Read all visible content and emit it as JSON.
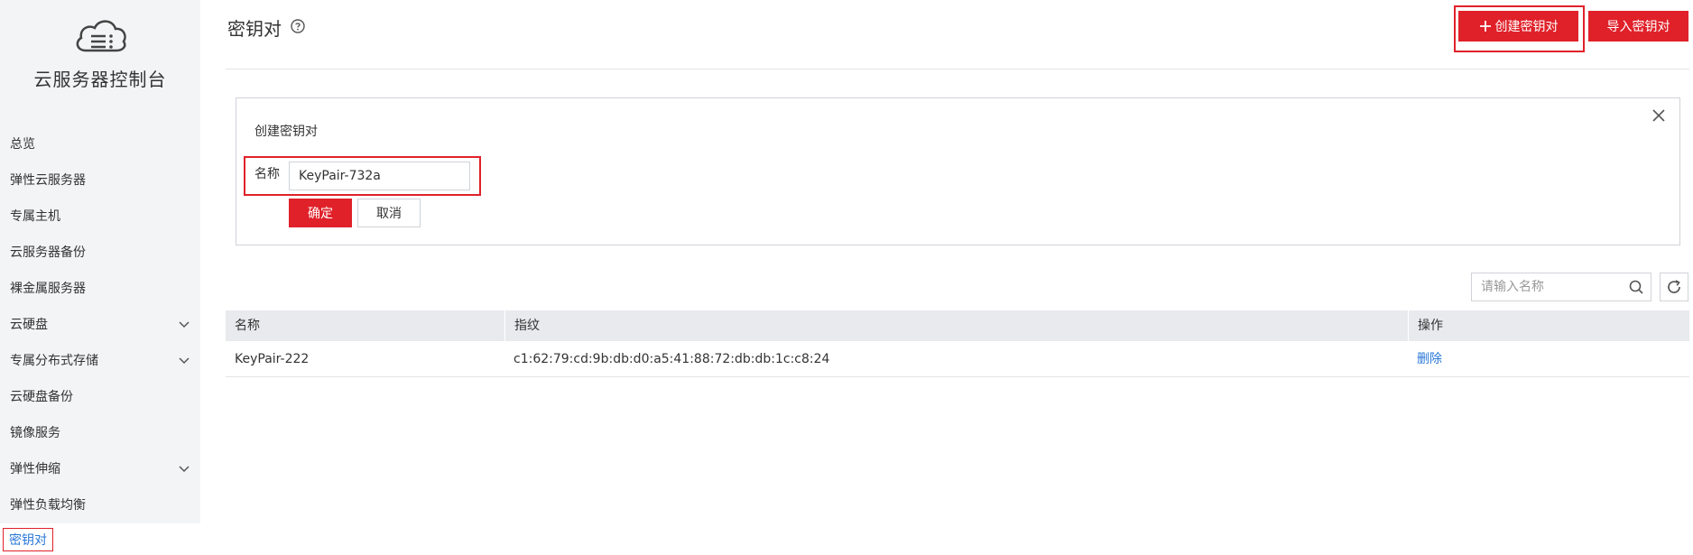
{
  "sidebar": {
    "title": "云服务器控制台",
    "logo_icon": "cloud-server-icon",
    "items": [
      {
        "label": "总览",
        "has_children": false
      },
      {
        "label": "弹性云服务器",
        "has_children": false
      },
      {
        "label": "专属主机",
        "has_children": false
      },
      {
        "label": "云服务器备份",
        "has_children": false
      },
      {
        "label": "裸金属服务器",
        "has_children": false
      },
      {
        "label": "云硬盘",
        "has_children": true
      },
      {
        "label": "专属分布式存储",
        "has_children": true
      },
      {
        "label": "云硬盘备份",
        "has_children": false
      },
      {
        "label": "镜像服务",
        "has_children": false
      },
      {
        "label": "弹性伸缩",
        "has_children": true
      },
      {
        "label": "弹性负载均衡",
        "has_children": false
      }
    ],
    "active_item": "密钥对"
  },
  "header": {
    "title": "密钥对",
    "create_button": "创建密钥对",
    "import_button": "导入密钥对"
  },
  "create_panel": {
    "title": "创建密钥对",
    "name_label": "名称",
    "name_value": "KeyPair-732a",
    "ok_button": "确定",
    "cancel_button": "取消"
  },
  "search": {
    "placeholder": "请输入名称"
  },
  "table": {
    "headers": {
      "name": "名称",
      "fingerprint": "指纹",
      "operation": "操作"
    },
    "rows": [
      {
        "name": "KeyPair-222",
        "fingerprint": "c1:62:79:cd:9b:db:d0:a5:41:88:72:db:db:1c:c8:24",
        "action": "删除"
      }
    ]
  },
  "colors": {
    "accent": "#e0212a",
    "link": "#2a78d8",
    "sidebar_bg": "#f3f4f6",
    "table_header_bg": "#e8eaed"
  }
}
